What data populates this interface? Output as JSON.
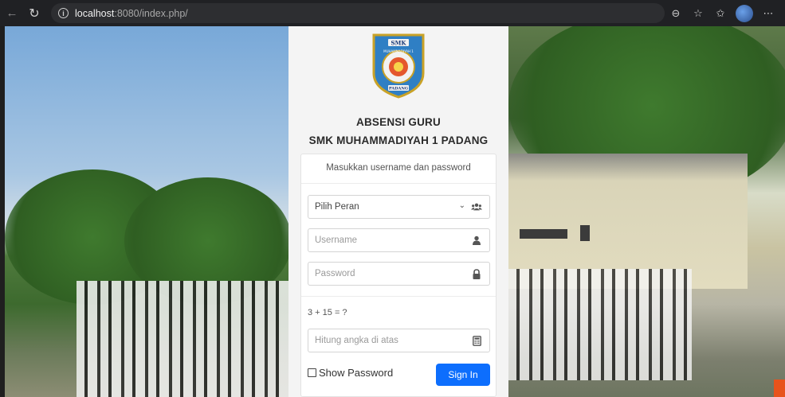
{
  "browser": {
    "address": {
      "host": "localhost",
      "path": ":8080/index.php/"
    },
    "icons": {
      "back": "back-arrow-icon",
      "refresh": "refresh-icon",
      "info": "info-icon",
      "zoom": "zoom-icon",
      "favorite": "star-icon",
      "collections": "favorites-list-icon",
      "profile": "profile-avatar",
      "menu": "more-menu-icon"
    },
    "glyphs": {
      "back": "←",
      "refresh": "↻",
      "info": "i",
      "zoom": "⊖",
      "favorite": "☆",
      "collections": "✩",
      "menu": "⋯"
    }
  },
  "header": {
    "title1": "ABSENSI GURU",
    "title2": "SMK MUHAMMADIYAH 1 PADANG",
    "logo": {
      "top": "SMK",
      "ring": "MUHAMMADIYAH 1",
      "bottom": "PADANG"
    }
  },
  "form": {
    "hint": "Masukkan username dan password",
    "role_select": {
      "value": "Pilih Peran",
      "icon": "users-icon"
    },
    "username": {
      "placeholder": "Username",
      "icon": "user-icon"
    },
    "password": {
      "placeholder": "Password",
      "icon": "lock-icon"
    },
    "captcha_question": "3 + 15 = ?",
    "captcha_answer": {
      "placeholder": "Hitung angka di atas",
      "icon": "calculator-icon"
    },
    "show_password_label": "Show Password",
    "sign_in_label": "Sign In"
  },
  "colors": {
    "primary": "#0d6efd",
    "panel": "#f4f4f4",
    "chrome": "#202124"
  }
}
